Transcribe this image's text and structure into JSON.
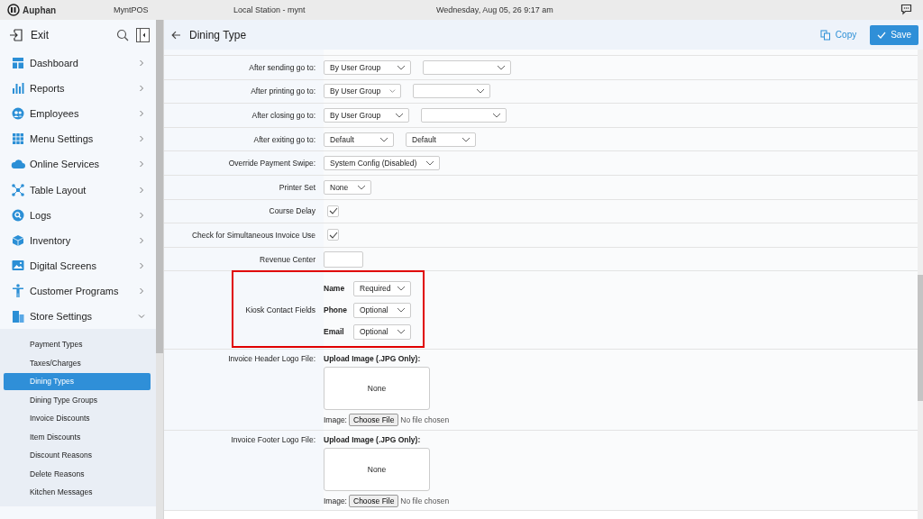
{
  "top_bar": {
    "brand": "Auphan",
    "app": "MyntPOS",
    "station": "Local Station - mynt",
    "datetime": "Wednesday, Aug 05, 26 9:17 am"
  },
  "sidebar": {
    "exit": "Exit",
    "items": [
      {
        "label": "Dashboard",
        "expanded": false
      },
      {
        "label": "Reports",
        "expanded": false
      },
      {
        "label": "Employees",
        "expanded": false
      },
      {
        "label": "Menu Settings",
        "expanded": false
      },
      {
        "label": "Online Services",
        "expanded": false
      },
      {
        "label": "Table Layout",
        "expanded": false
      },
      {
        "label": "Logs",
        "expanded": false
      },
      {
        "label": "Inventory",
        "expanded": false
      },
      {
        "label": "Digital Screens",
        "expanded": false
      },
      {
        "label": "Customer Programs",
        "expanded": false
      },
      {
        "label": "Store Settings",
        "expanded": true,
        "children": [
          {
            "label": "Payment Types",
            "selected": false
          },
          {
            "label": "Taxes/Charges",
            "selected": false
          },
          {
            "label": "Dining Types",
            "selected": true
          },
          {
            "label": "Dining Type Groups",
            "selected": false
          },
          {
            "label": "Invoice Discounts",
            "selected": false
          },
          {
            "label": "Item Discounts",
            "selected": false
          },
          {
            "label": "Discount Reasons",
            "selected": false
          },
          {
            "label": "Delete Reasons",
            "selected": false
          },
          {
            "label": "Kitchen Messages",
            "selected": false
          }
        ]
      }
    ]
  },
  "header": {
    "title": "Dining Type",
    "copy": "Copy",
    "save": "Save"
  },
  "form": [
    {
      "kind": "select_pair",
      "label": "After sending go to:",
      "value": "By User Group"
    },
    {
      "kind": "select_pair",
      "label": "After printing go to:",
      "value": "By User Group"
    },
    {
      "kind": "select_pair",
      "label": "After closing go to:",
      "value": "By User Group"
    },
    {
      "kind": "select_pair",
      "label": "After exiting go to:",
      "value": "Default",
      "value2": "Default"
    },
    {
      "kind": "select",
      "label": "Override Payment Swipe:",
      "value": "System Config (Disabled)"
    },
    {
      "kind": "select",
      "label": "Printer Set",
      "value": "None"
    },
    {
      "kind": "checkbox",
      "label": "Course Delay",
      "checked": true
    },
    {
      "kind": "checkbox",
      "label": "Check for Simultaneous Invoice Use",
      "checked": true
    },
    {
      "kind": "text",
      "label": "Revenue Center"
    },
    {
      "kind": "contact_fields",
      "label": "Kiosk Contact Fields",
      "highlighted": true,
      "fields": [
        {
          "name": "Name",
          "value": "Required"
        },
        {
          "name": "Phone",
          "value": "Optional"
        },
        {
          "name": "Email",
          "value": "Optional"
        }
      ]
    },
    {
      "kind": "upload",
      "label": "Invoice Header Logo File:",
      "heading": "Upload Image (.JPG Only):",
      "preview": "None",
      "image_label": "Image:",
      "button": "Choose File",
      "status": "No file chosen"
    },
    {
      "kind": "upload",
      "label": "Invoice Footer Logo File:",
      "heading": "Upload Image (.JPG Only):",
      "preview": "None",
      "image_label": "Image:",
      "button": "Choose File",
      "status": "No file chosen"
    }
  ]
}
